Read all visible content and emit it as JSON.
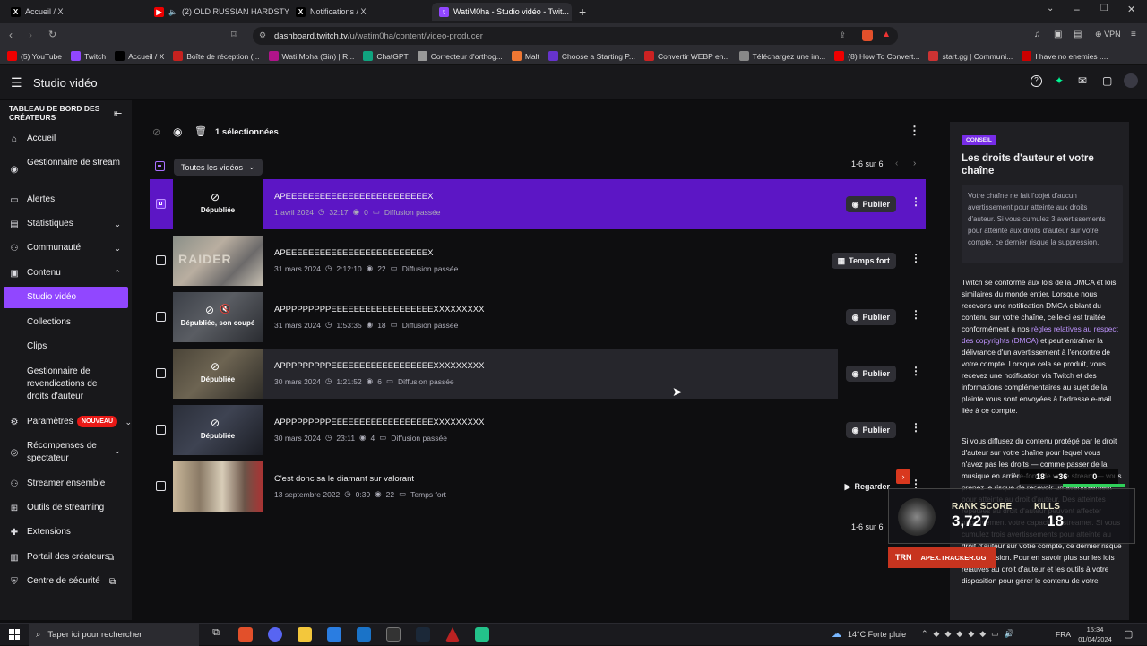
{
  "browser": {
    "tabs": [
      {
        "label": "Accueil / X"
      },
      {
        "label": "(2) OLD RUSSIAN HARDSTYLE P..."
      },
      {
        "label": "Notifications / X"
      },
      {
        "label": "WatiM0ha - Studio vidéo - Twit..."
      }
    ],
    "url_domain": "dashboard.twitch.tv",
    "url_path": "/u/watim0ha/content/video-producer",
    "vpn_label": "VPN",
    "bookmarks": [
      "(5) YouTube",
      "Twitch",
      "Accueil / X",
      "Boîte de réception (...",
      "Wati Moha (Sin) | R...",
      "ChatGPT",
      "Correcteur d'orthog...",
      "Malt",
      "Choose a Starting P...",
      "Convertir WEBP en...",
      "Téléchargez une im...",
      "(8) How To Convert...",
      "start.gg | Communi...",
      "I have no enemies ...."
    ]
  },
  "topbar": {
    "title": "Studio vidéo"
  },
  "sidebar": {
    "heading": "TABLEAU DE BORD DES CRÉATEURS",
    "items": [
      {
        "label": "Accueil",
        "icon": "home-icon"
      },
      {
        "label": "Gestionnaire de stream",
        "icon": "broadcast-icon"
      },
      {
        "label": "Alertes",
        "icon": "bell-icon"
      },
      {
        "label": "Statistiques",
        "icon": "chart-icon"
      },
      {
        "label": "Communauté",
        "icon": "users-icon"
      },
      {
        "label": "Contenu",
        "icon": "content-icon"
      },
      {
        "label": "Studio vidéo"
      },
      {
        "label": "Collections"
      },
      {
        "label": "Clips"
      },
      {
        "label": "Gestionnaire de revendications de droits d'auteur"
      },
      {
        "label": "Paramètres",
        "icon": "gear-icon",
        "badge": "NOUVEAU"
      },
      {
        "label": "Récompenses de spectateur",
        "icon": "reward-icon"
      },
      {
        "label": "Streamer ensemble",
        "icon": "collab-icon"
      },
      {
        "label": "Outils de streaming",
        "icon": "tools-icon"
      },
      {
        "label": "Extensions",
        "icon": "extension-icon"
      },
      {
        "label": "Portail des créateurs",
        "icon": "portal-icon"
      },
      {
        "label": "Centre de sécurité",
        "icon": "shield-icon"
      }
    ]
  },
  "main": {
    "selected_count": "1 sélectionnées",
    "filter": "Toutes les vidéos",
    "pagination_top": "1-6 sur 6",
    "pagination_bottom": "1-6 sur 6",
    "videos": [
      {
        "title": "APEEEEEEEEEEEEEEEEEEEEEEEEEX",
        "date": "1 avril 2024",
        "duration": "32:17",
        "views": "0",
        "type": "Diffusion passée",
        "status": "Dépubliée",
        "action": "Publier",
        "selected": true
      },
      {
        "title": "APEEEEEEEEEEEEEEEEEEEEEEEEEX",
        "date": "31 mars 2024",
        "duration": "2:12:10",
        "views": "22",
        "type": "Diffusion passée",
        "status": "",
        "action": "Temps fort",
        "selected": false
      },
      {
        "title": "APPPPPPPPPEEEEEEEEEEEEEEEEEEXXXXXXXXX",
        "date": "31 mars 2024",
        "duration": "1:53:35",
        "views": "18",
        "type": "Diffusion passée",
        "status": "Dépubliée, son coupé",
        "action": "Publier",
        "selected": false
      },
      {
        "title": "APPPPPPPPPEEEEEEEEEEEEEEEEEEXXXXXXXXX",
        "date": "30 mars 2024",
        "duration": "1:21:52",
        "views": "6",
        "type": "Diffusion passée",
        "status": "Dépubliée",
        "action": "Publier",
        "selected": false
      },
      {
        "title": "APPPPPPPPPEEEEEEEEEEEEEEEEEEXXXXXXXXX",
        "date": "30 mars 2024",
        "duration": "23:11",
        "views": "4",
        "type": "Diffusion passée",
        "status": "Dépubliée",
        "action": "Publier",
        "selected": false
      },
      {
        "title": "C'est donc sa le diamant sur valorant",
        "date": "13 septembre 2022",
        "duration": "0:39",
        "views": "22",
        "type": "Temps fort",
        "status": "",
        "action": "Regarder",
        "selected": false
      }
    ]
  },
  "panel": {
    "tag": "CONSEIL",
    "title": "Les droits d'auteur et votre chaîne",
    "notice": "Votre chaîne ne fait l'objet d'aucun avertissement pour atteinte aux droits d'auteur. Si vous cumulez 3 avertissements pour atteinte aux droits d'auteur sur votre compte, ce dernier risque la suppression.",
    "para1_a": "Twitch se conforme aux lois de la DMCA et lois similaires du monde entier. Lorsque nous recevons une notification DMCA ciblant du contenu sur votre chaîne, celle-ci est traitée conformément à nos ",
    "para1_link": "règles relatives au respect des copyrights (DMCA)",
    "para1_b": " et peut entraîner la délivrance d'un avertissement à l'encontre de votre compte. Lorsque cela se produit, vous recevez une notification via Twitch et des informations complémentaires au sujet de la plainte vous sont envoyées à l'adresse e-mail liée à ce compte.",
    "para2": "Si vous diffusez du contenu protégé par le droit d'auteur sur votre chaîne pour lequel vous n'avez pas les droits — comme passer de la musique en arrière-fond de votre stream — vous prenez le risque de recevoir un avertissement pour atteinte au droit d'auteur. Des atteintes répétées au droit d'auteur peuvent affecter négativement votre capacité à streamer. Si vous cumulez trois avertissements pour atteinte au droit d'auteur sur votre compte, ce dernier risque la suppression. Pour en savoir plus sur les lois relatives au droit d'auteur et les outils à votre disposition pour gérer le contenu de votre"
  },
  "overlay": {
    "rank_label": "RANK SCORE",
    "rank_value": "3,727",
    "kills_label": "KILLS",
    "kills_value": "18",
    "small_a": "18",
    "small_b": "+36",
    "small_c": "0",
    "brand": "TRN",
    "site": "APEX.TRACKER.GG"
  },
  "taskbar": {
    "search_placeholder": "Taper ici pour rechercher",
    "weather": "14°C  Forte pluie",
    "lang": "FRA",
    "time": "15:34",
    "date": "01/04/2024"
  },
  "colors": {
    "accent": "#772ce8",
    "link": "#bf94ff",
    "bg": "#0e0e10"
  }
}
